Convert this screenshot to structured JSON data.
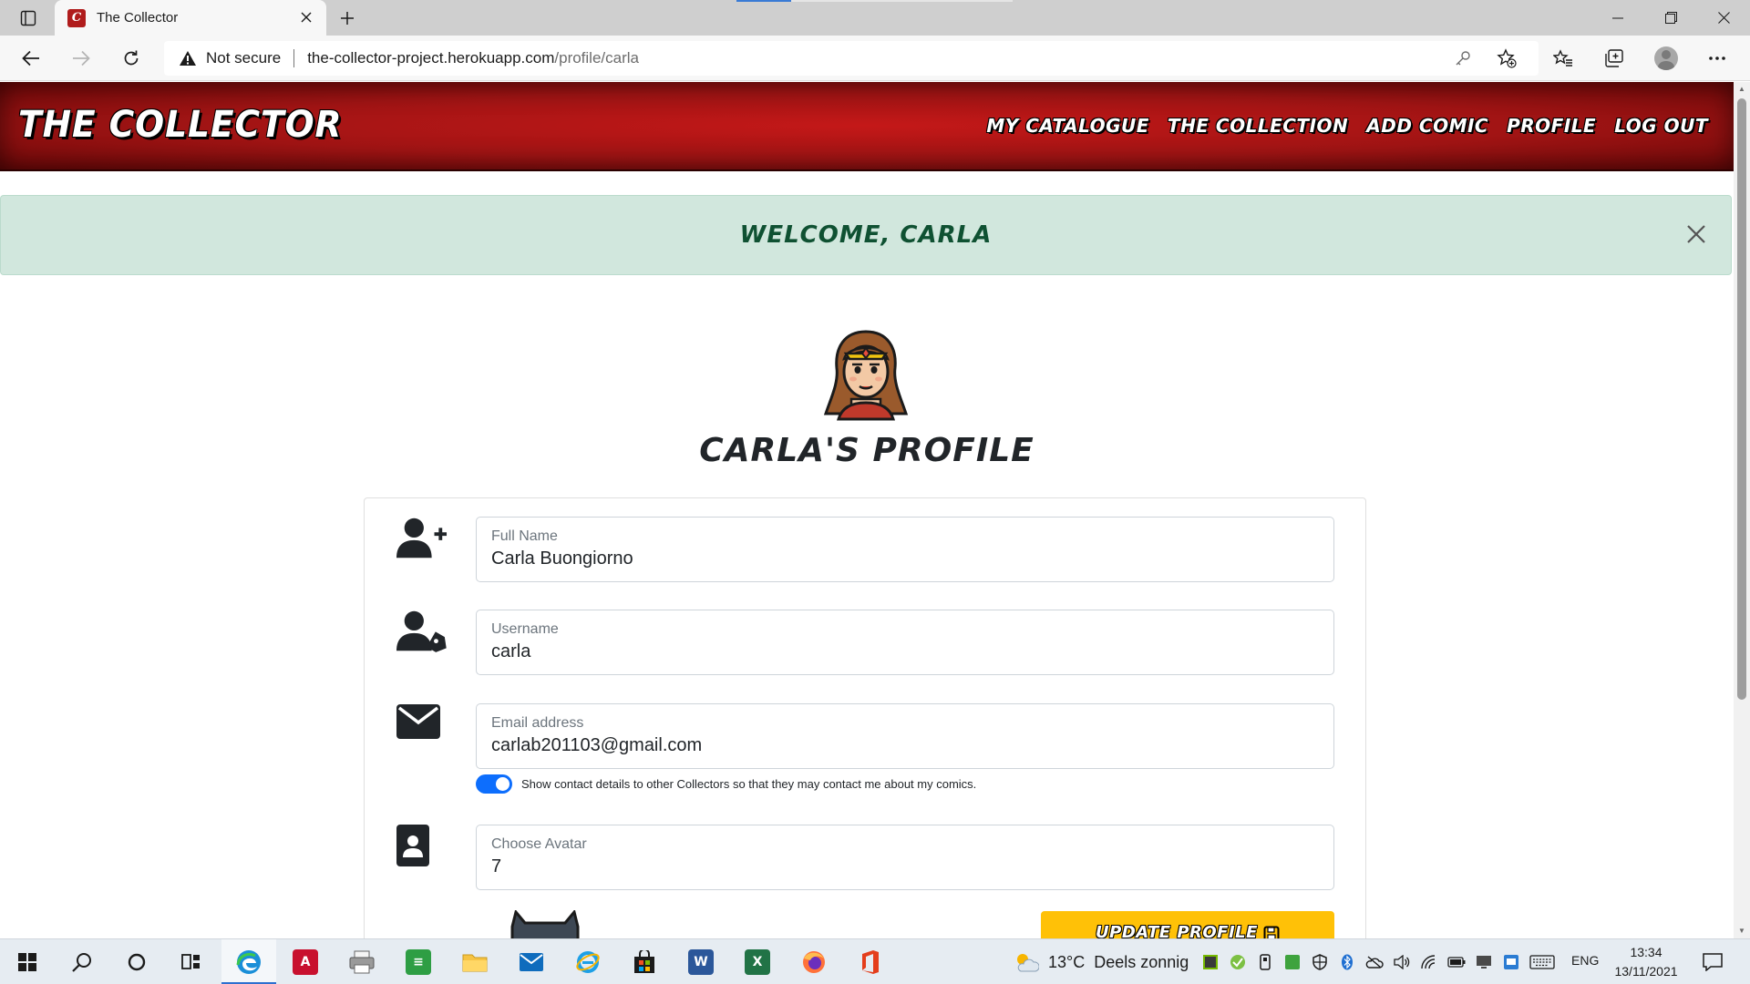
{
  "browser": {
    "tab_title": "The Collector",
    "security_label": "Not secure",
    "url_host": "the-collector-project.herokuapp.com",
    "url_path": "/profile/carla"
  },
  "site": {
    "brand": "THE COLLECTOR",
    "nav": [
      "MY CATALOGUE",
      "THE COLLECTION",
      "ADD COMIC",
      "PROFILE",
      "LOG OUT"
    ],
    "header_color": "#a01414"
  },
  "alert": {
    "message": "WELCOME, CARLA",
    "background": "#d1e7dd"
  },
  "profile": {
    "title": "CARLA'S PROFILE",
    "fields": {
      "full_name": {
        "label": "Full Name",
        "value": "Carla Buongiorno"
      },
      "username": {
        "label": "Username",
        "value": "carla"
      },
      "email": {
        "label": "Email address",
        "value": "carlab201103@gmail.com"
      },
      "avatar": {
        "label": "Choose Avatar",
        "value": "7"
      }
    },
    "show_contact": {
      "checked": true,
      "label": "Show contact details to other Collectors so that they may contact me about my comics."
    },
    "update_button": "UPDATE PROFILE",
    "accent": "#ffc107"
  },
  "taskbar": {
    "apps": [
      "start-icon",
      "search-icon",
      "cortana-icon",
      "task-view-icon",
      "edge-icon",
      "acrobat-icon",
      "printer-icon",
      "notes-icon",
      "file-explorer-icon",
      "mail-icon",
      "internet-explorer-icon",
      "store-icon",
      "word-icon",
      "excel-icon",
      "firefox-icon",
      "office-icon"
    ],
    "weather_temp": "13°C",
    "weather_text": "Deels zonnig",
    "language": "ENG",
    "time": "13:34",
    "date": "13/11/2021"
  }
}
